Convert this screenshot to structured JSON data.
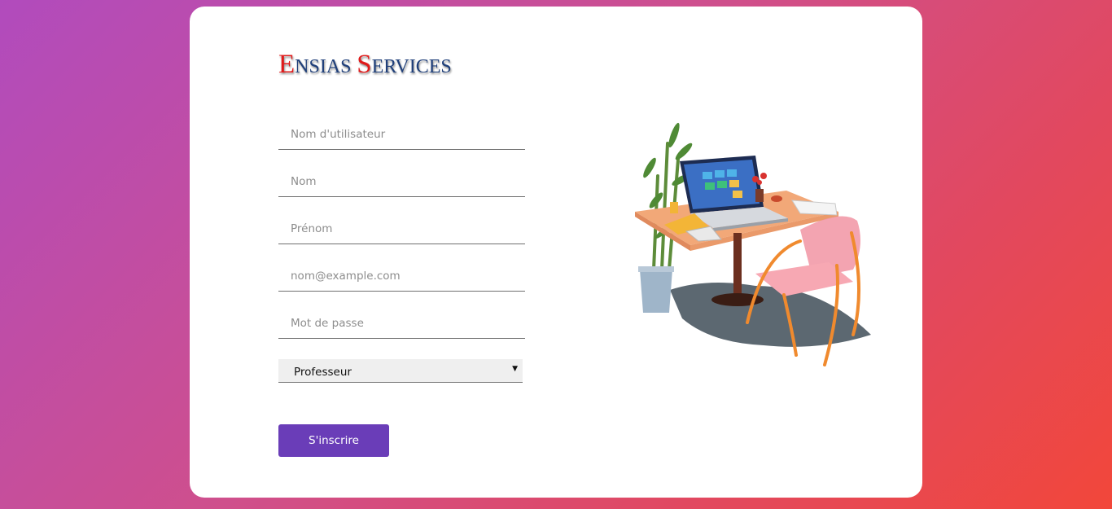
{
  "brand": {
    "cap1": "E",
    "rest1": "NSIAS",
    "cap2": "S",
    "rest2": "ERVICES"
  },
  "form": {
    "username_placeholder": "Nom d'utilisateur",
    "lastname_placeholder": "Nom",
    "firstname_placeholder": "Prénom",
    "email_placeholder": "nom@example.com",
    "password_placeholder": "Mot de passe",
    "role_selected": "Professeur",
    "submit_label": "S'inscrire"
  },
  "colors": {
    "accent": "#6a3db8",
    "brand_red": "#e01b1b",
    "brand_blue": "#1f3f7a"
  },
  "icons": {
    "select_arrow": "caret-down-icon"
  }
}
